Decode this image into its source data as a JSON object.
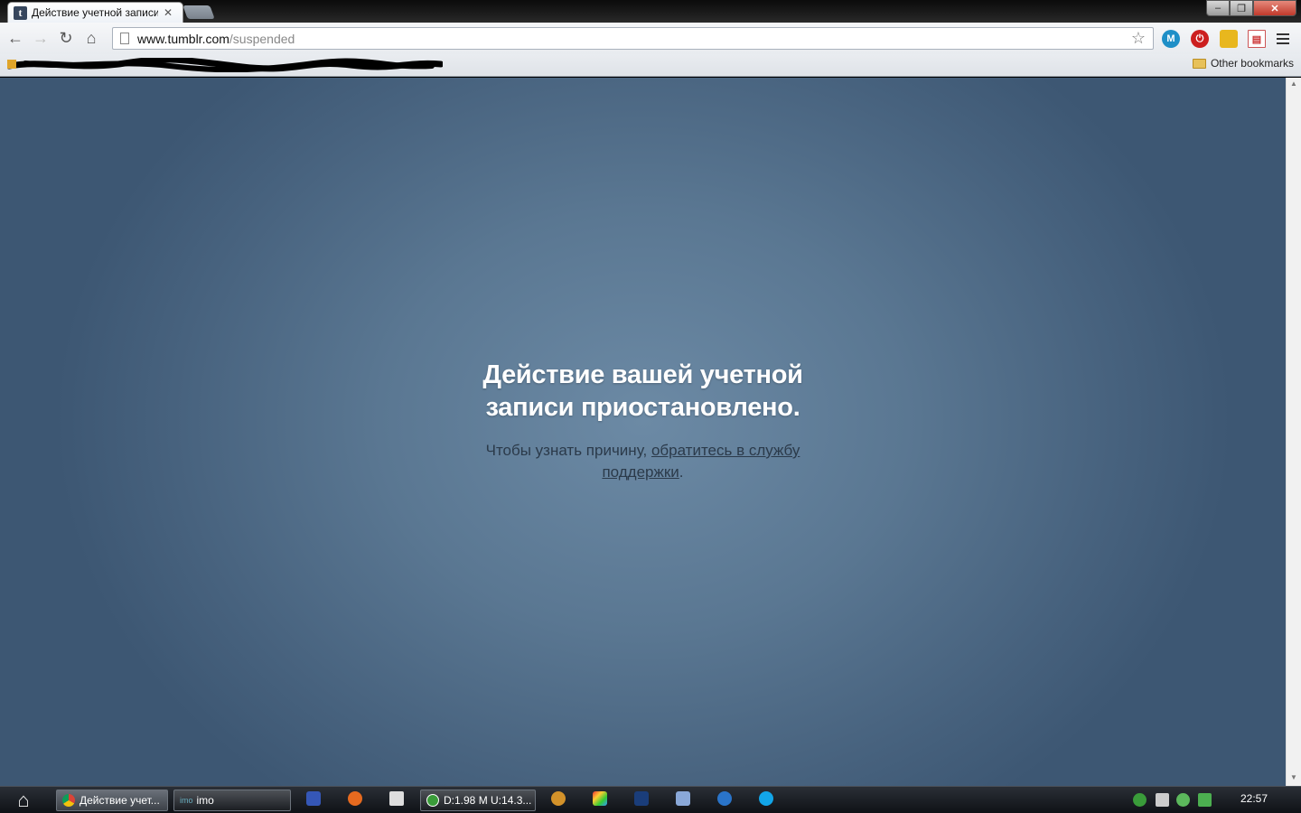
{
  "browser": {
    "tab": {
      "title": "Действие учетной записи приостановлено",
      "favicon_letter": "t"
    },
    "window_controls": {
      "minimize": "–",
      "maximize": "❐",
      "close": "✕"
    },
    "url": {
      "host": "www.tumblr.com",
      "path": "/suspended"
    },
    "extensions": [
      {
        "name": "m-extension-icon",
        "label": "M"
      },
      {
        "name": "stop-extension-icon",
        "label": "⏻"
      },
      {
        "name": "ie-tab-extension-icon",
        "label": ""
      },
      {
        "name": "calendar-extension-icon",
        "label": ""
      }
    ],
    "bookmarks": {
      "other_label": "Other bookmarks"
    }
  },
  "page": {
    "title": "Действие вашей учетной записи приостановлено.",
    "text_prefix": "Чтобы узнать причину, ",
    "link_text": "обратитесь в службу поддержки",
    "text_suffix": ".",
    "colors": {
      "bg_center": "#6c8aa5",
      "bg_edge": "#3d5773",
      "title": "#ffffff",
      "text": "#2b3a4a"
    }
  },
  "taskbar": {
    "items": [
      {
        "label": "Действие учет..."
      },
      {
        "label": "imo",
        "mini": "imo"
      },
      {
        "label": "D:1.98 M U:14.3..."
      }
    ],
    "clock": "22:57"
  }
}
